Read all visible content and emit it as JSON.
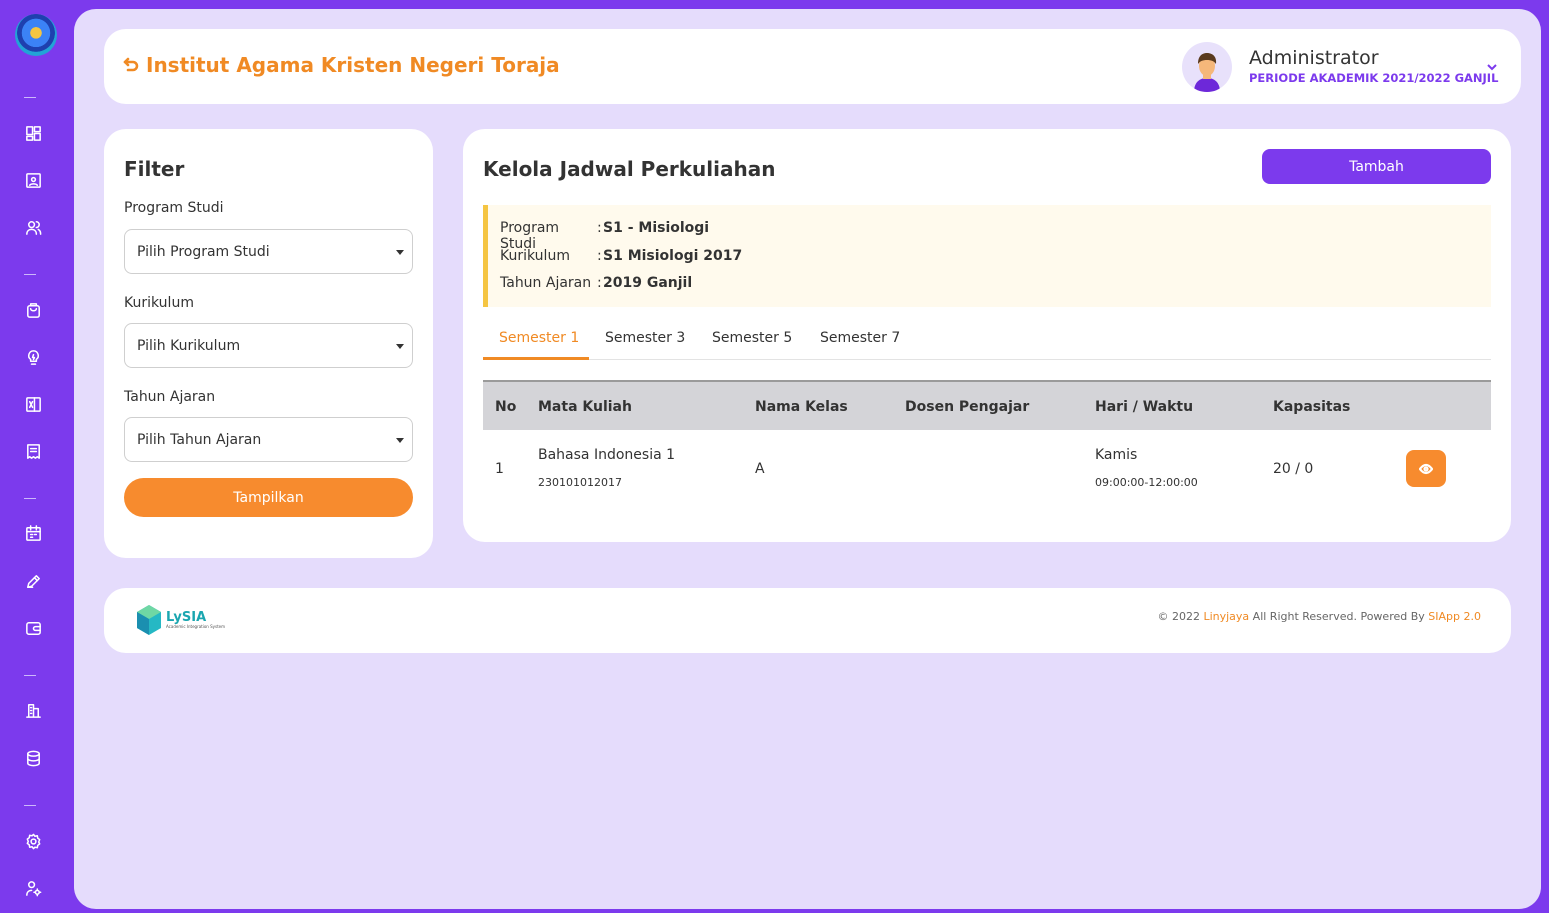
{
  "header": {
    "institution": "Institut Agama Kristen Negeri Toraja",
    "user_name": "Administrator",
    "period": "PERIODE AKADEMIK 2021/2022 GANJIL"
  },
  "sidebar": {
    "icons": [
      "dashboard-icon",
      "id-card-icon",
      "users-icon",
      "bag-icon",
      "lightbulb-icon",
      "excel-icon",
      "receipt-icon",
      "calendar-icon",
      "pencil-icon",
      "wallet-icon",
      "building-icon",
      "database-icon",
      "settings-icon",
      "user-settings-icon"
    ]
  },
  "filter": {
    "title": "Filter",
    "program_label": "Program Studi",
    "program_value": "Pilih Program Studi",
    "kurikulum_label": "Kurikulum",
    "kurikulum_value": "Pilih Kurikulum",
    "tahun_label": "Tahun Ajaran",
    "tahun_value": "Pilih Tahun Ajaran",
    "button": "Tampilkan"
  },
  "jadwal": {
    "title": "Kelola Jadwal Perkuliahan",
    "add_button": "Tambah",
    "info": {
      "program_label": "Program Studi",
      "program_value": "S1 - Misiologi",
      "kurikulum_label": "Kurikulum",
      "kurikulum_value": "S1 Misiologi 2017",
      "tahun_label": "Tahun Ajaran",
      "tahun_value": "2019 Ganjil",
      "separator": ":"
    },
    "tabs": [
      "Semester 1",
      "Semester 3",
      "Semester 5",
      "Semester 7"
    ],
    "active_tab": "Semester 1",
    "columns": [
      "No",
      "Mata Kuliah",
      "Nama Kelas",
      "Dosen Pengajar",
      "Hari / Waktu",
      "Kapasitas"
    ],
    "rows": [
      {
        "no": "1",
        "mata_kuliah": "Bahasa Indonesia 1",
        "kode": "230101012017",
        "kelas": "A",
        "dosen": "",
        "hari": "Kamis",
        "waktu": "09:00:00-12:00:00",
        "kapasitas": "20 / 0"
      }
    ]
  },
  "footer": {
    "brand": "LySIA",
    "brand_sub": "Academic Integration System",
    "copy_prefix": "© 2022",
    "company": "Linyjaya",
    "copy_middle": "All Right Reserved. Powered By",
    "product": "SIApp 2.0"
  },
  "colors": {
    "primary": "#7c3aed",
    "accent": "#f08a24",
    "background": "#e5dcfc"
  }
}
